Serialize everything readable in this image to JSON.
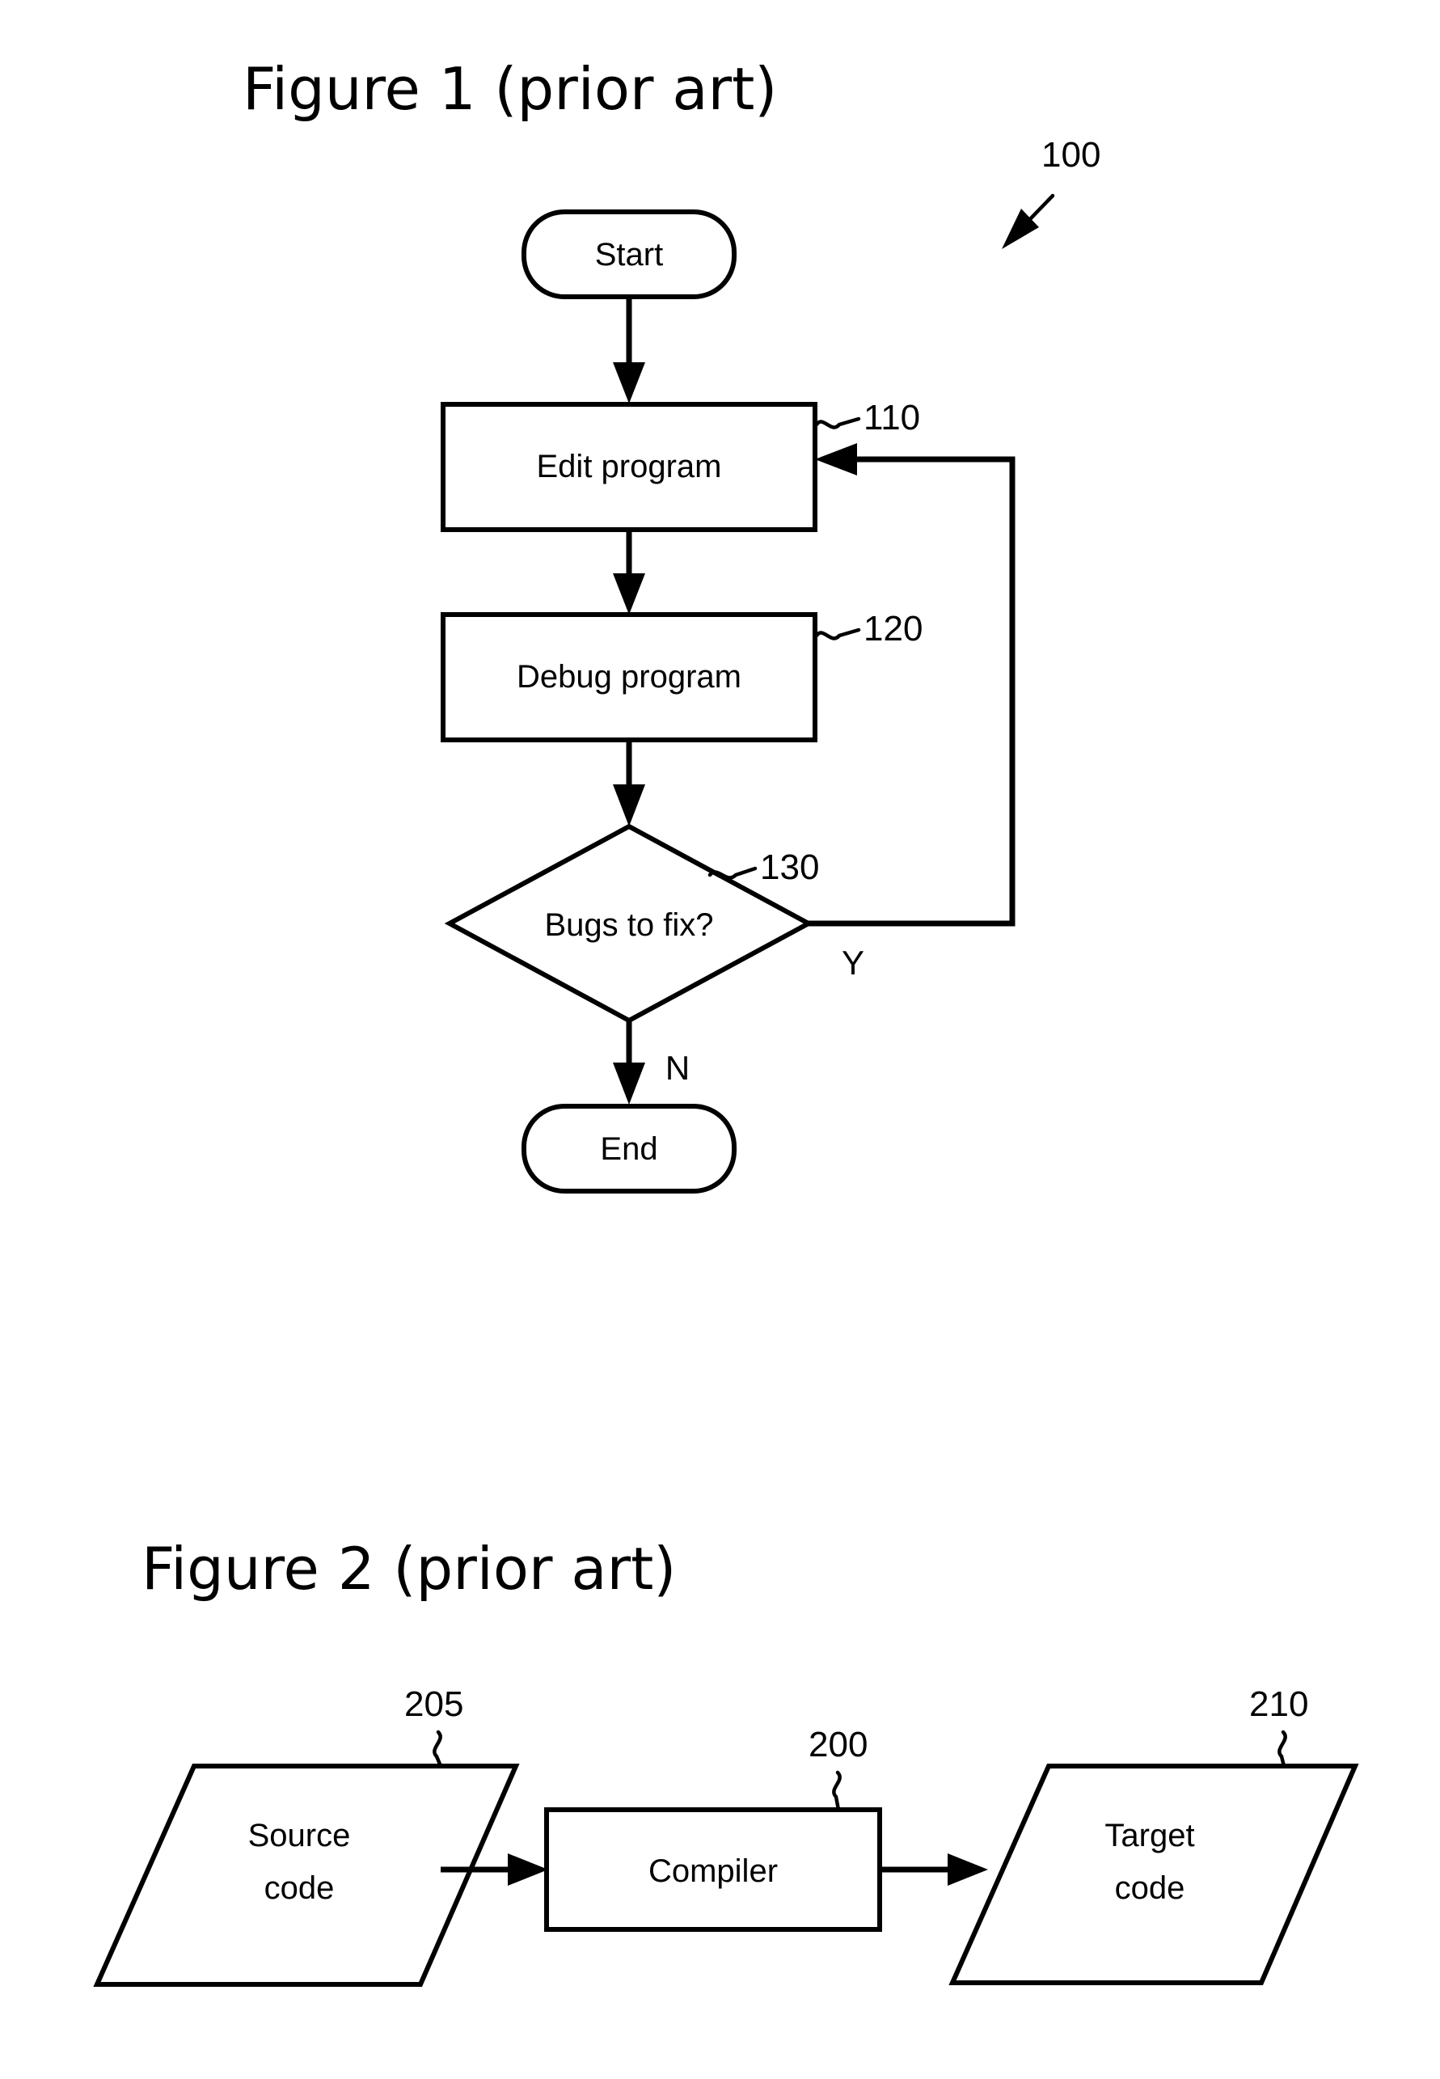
{
  "document": {
    "type": "patent-drawing-sheet",
    "background_color": "#ffffff",
    "ink_color": "#000000"
  },
  "figures": [
    {
      "id": "figure-1",
      "title": "Figure 1 (prior art)",
      "reference_numeral": "100",
      "diagram_type": "flowchart",
      "nodes": [
        {
          "id": "start",
          "label": "Start",
          "shape": "stadium",
          "ref": ""
        },
        {
          "id": "edit",
          "label": "Edit program",
          "shape": "rectangle",
          "ref": "110"
        },
        {
          "id": "debug",
          "label": "Debug program",
          "shape": "rectangle",
          "ref": "120"
        },
        {
          "id": "decision",
          "label": "Bugs to fix?",
          "shape": "diamond",
          "ref": "130"
        },
        {
          "id": "end",
          "label": "End",
          "shape": "stadium",
          "ref": ""
        }
      ],
      "edges": [
        {
          "from": "start",
          "to": "edit",
          "label": ""
        },
        {
          "from": "edit",
          "to": "debug",
          "label": ""
        },
        {
          "from": "debug",
          "to": "decision",
          "label": ""
        },
        {
          "from": "decision",
          "to": "edit",
          "label": "Y"
        },
        {
          "from": "decision",
          "to": "end",
          "label": "N"
        }
      ],
      "branch_labels": {
        "yes": "Y",
        "no": "N"
      }
    },
    {
      "id": "figure-2",
      "title": "Figure 2 (prior art)",
      "diagram_type": "block-dataflow",
      "nodes": [
        {
          "id": "source",
          "label_line1": "Source",
          "label_line2": "code",
          "shape": "parallelogram",
          "ref": "205"
        },
        {
          "id": "compiler",
          "label_line1": "Compiler",
          "label_line2": "",
          "shape": "rectangle",
          "ref": "200"
        },
        {
          "id": "target",
          "label_line1": "Target",
          "label_line2": "code",
          "shape": "parallelogram",
          "ref": "210"
        }
      ],
      "edges": [
        {
          "from": "source",
          "to": "compiler",
          "label": ""
        },
        {
          "from": "compiler",
          "to": "target",
          "label": ""
        }
      ]
    }
  ]
}
